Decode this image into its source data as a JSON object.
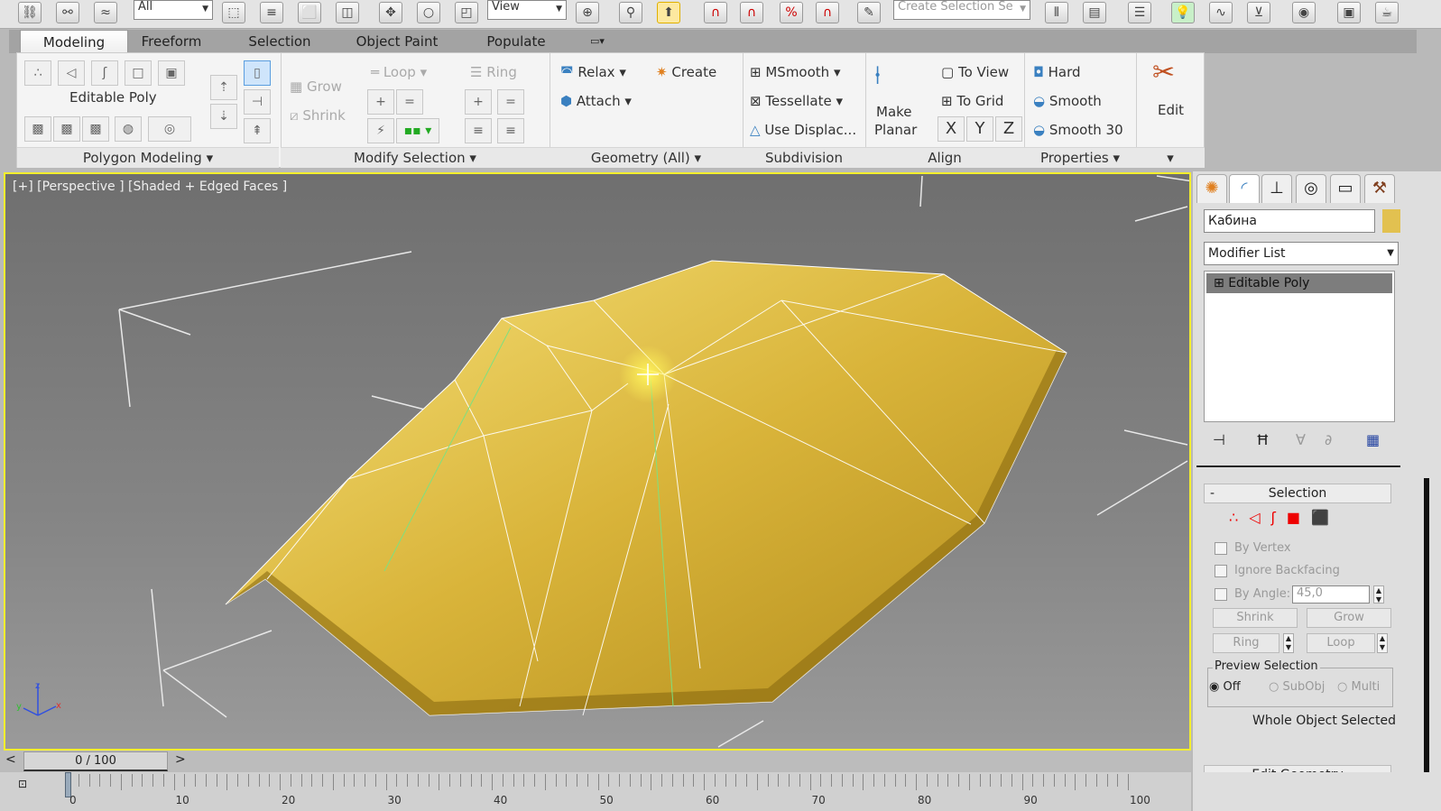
{
  "toolbar": {
    "filter_select": "All",
    "coord_select": "View",
    "named_selection_placeholder": "Create Selection Se",
    "icons": [
      "link-icon",
      "unlink-icon",
      "bind-space-warp-icon",
      "select-object-icon",
      "select-by-name-icon",
      "rect-selection-icon",
      "window-crossing-icon",
      "move-icon",
      "rotate-icon",
      "scale-icon",
      "pivot-icon",
      "select-manipulate-icon",
      "keyboard-shortcut-icon",
      "snap-icon",
      "angle-snap-icon",
      "percent-snap-icon",
      "spinner-snap-icon",
      "edit-named-sel-icon",
      "mirror-icon",
      "align-icon",
      "layer-icon",
      "scene-explorer-icon",
      "curve-editor-icon",
      "schematic-icon",
      "material-editor-icon",
      "render-setup-icon",
      "render-icon"
    ]
  },
  "ribbon": {
    "tabs": [
      "Modeling",
      "Freeform",
      "Selection",
      "Object Paint",
      "Populate"
    ],
    "active_tab": "Modeling",
    "polygon_modeling": {
      "label": "Editable Poly",
      "footer": "Polygon Modeling"
    },
    "modify_selection": {
      "grow": "Grow",
      "shrink": "Shrink",
      "loop": "Loop",
      "ring": "Ring",
      "footer": "Modify Selection"
    },
    "geometry": {
      "relax": "Relax",
      "create": "Create",
      "attach": "Attach",
      "footer": "Geometry (All)"
    },
    "subdivision": {
      "msmooth": "MSmooth",
      "tessellate": "Tessellate",
      "use_displace": "Use Displac...",
      "footer": "Subdivision"
    },
    "align": {
      "make_planar_1": "Make",
      "make_planar_2": "Planar",
      "to_view": "To View",
      "to_grid": "To Grid",
      "x": "X",
      "y": "Y",
      "z": "Z",
      "footer": "Align"
    },
    "properties": {
      "hard": "Hard",
      "smooth": "Smooth",
      "smooth30": "Smooth 30",
      "footer": "Properties"
    },
    "edit": {
      "label": "Edit"
    }
  },
  "viewport": {
    "label": "[+] [Perspective ] [Shaded + Edged Faces ]",
    "axis_x": "x",
    "axis_y": "y",
    "axis_z": "z"
  },
  "command_panel": {
    "object_name": "Кабина",
    "object_color": "#e2c150",
    "modifier_list": "Modifier List",
    "stack": [
      "Editable Poly"
    ],
    "selection": {
      "title": "Selection",
      "by_vertex": "By Vertex",
      "ignore_backfacing": "Ignore Backfacing",
      "by_angle": "By Angle:",
      "angle_value": "45,0",
      "shrink": "Shrink",
      "grow": "Grow",
      "ring": "Ring",
      "loop": "Loop",
      "preview_title": "Preview Selection",
      "off": "Off",
      "subobj": "SubObj",
      "multi": "Multi",
      "status": "Whole Object Selected"
    },
    "edit_geometry": {
      "title": "Edit Geometry"
    }
  },
  "timeline": {
    "frame": "0 / 100",
    "prev": "<",
    "next": ">",
    "start": 0,
    "end": 100,
    "current": 0,
    "labels": [
      "0",
      "10",
      "20",
      "30",
      "40",
      "50",
      "60",
      "70",
      "80",
      "90",
      "100"
    ]
  }
}
